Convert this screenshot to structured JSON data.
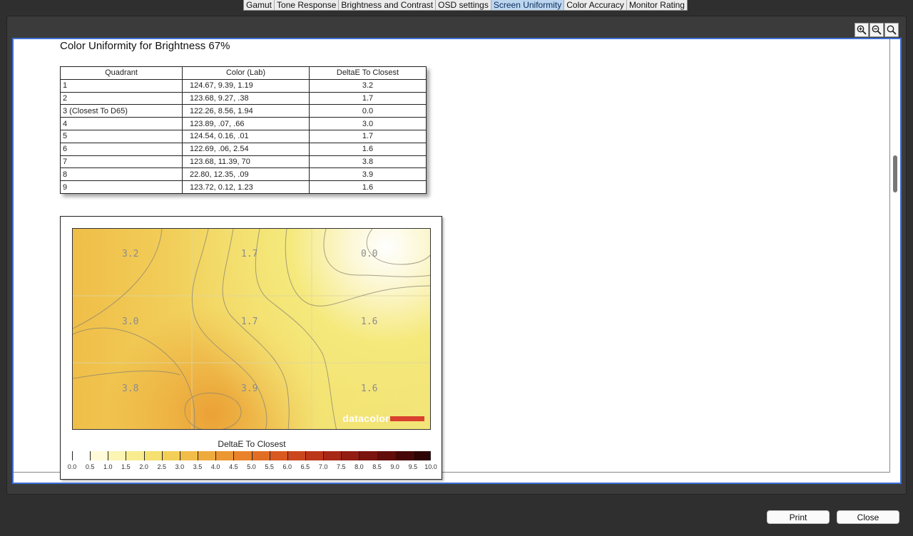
{
  "tabs": [
    {
      "label": "Gamut",
      "active": false
    },
    {
      "label": "Tone Response",
      "active": false
    },
    {
      "label": "Brightness and Contrast",
      "active": false
    },
    {
      "label": "OSD settings",
      "active": false
    },
    {
      "label": "Screen Uniformity",
      "active": true
    },
    {
      "label": "Color Accuracy",
      "active": false
    },
    {
      "label": "Monitor Rating",
      "active": false
    }
  ],
  "toolbar": {
    "icons": [
      "zoom-in-icon",
      "zoom-out-icon",
      "zoom-fit-icon"
    ]
  },
  "document": {
    "title": "Color Uniformity for Brightness 67%",
    "table": {
      "headers": [
        "Quadrant",
        "Color (Lab)",
        "DeltaE To Closest"
      ],
      "rows": [
        [
          "1",
          "124.67,  9.39,  1.19",
          "3.2"
        ],
        [
          "2",
          "123.68,  9.27,   .38",
          "1.7"
        ],
        [
          "3 (Closest To D65)",
          "122.26,  8.56,  1.94",
          "0.0"
        ],
        [
          "4",
          "123.89,   .07,   .66",
          "3.0"
        ],
        [
          "5",
          "124.54,  0.16,   .01",
          "1.7"
        ],
        [
          "6",
          "122.69,   .06,  2.54",
          "1.6"
        ],
        [
          "7",
          "123.68,  11.39,    70",
          "3.8"
        ],
        [
          "8",
          " 22.80,  12.35,   .09",
          "3.9"
        ],
        [
          "9",
          "123.72,  0.12,  1.23",
          "1.6"
        ]
      ]
    },
    "heatmap": {
      "values": [
        [
          "3.2",
          "1.7",
          "0.0"
        ],
        [
          "3.0",
          "1.7",
          "1.6"
        ],
        [
          "3.8",
          "3.9",
          "1.6"
        ]
      ],
      "watermark": "datacolor",
      "legend_title": "DeltaE To Closest",
      "scale_labels": [
        "0.0",
        "0.5",
        "1.0",
        "1.5",
        "2.0",
        "2.5",
        "3.0",
        "3.5",
        "4.0",
        "4.5",
        "5.0",
        "5.5",
        "6.0",
        "6.5",
        "7.0",
        "7.5",
        "8.0",
        "8.5",
        "9.0",
        "9.5",
        "10.0"
      ],
      "scale_colors": [
        "#ffffff",
        "#fffbd8",
        "#fbf4b2",
        "#f8ec8f",
        "#f5e070",
        "#f3cf57",
        "#f1bd48",
        "#eeaa3c",
        "#eb9733",
        "#e8832b",
        "#e26e25",
        "#d95a21",
        "#cc461d",
        "#bc361a",
        "#a82816",
        "#931d13",
        "#7b140f",
        "#620d0b",
        "#470707",
        "#2d0303"
      ]
    }
  },
  "buttons": {
    "print": "Print",
    "close": "Close"
  }
}
